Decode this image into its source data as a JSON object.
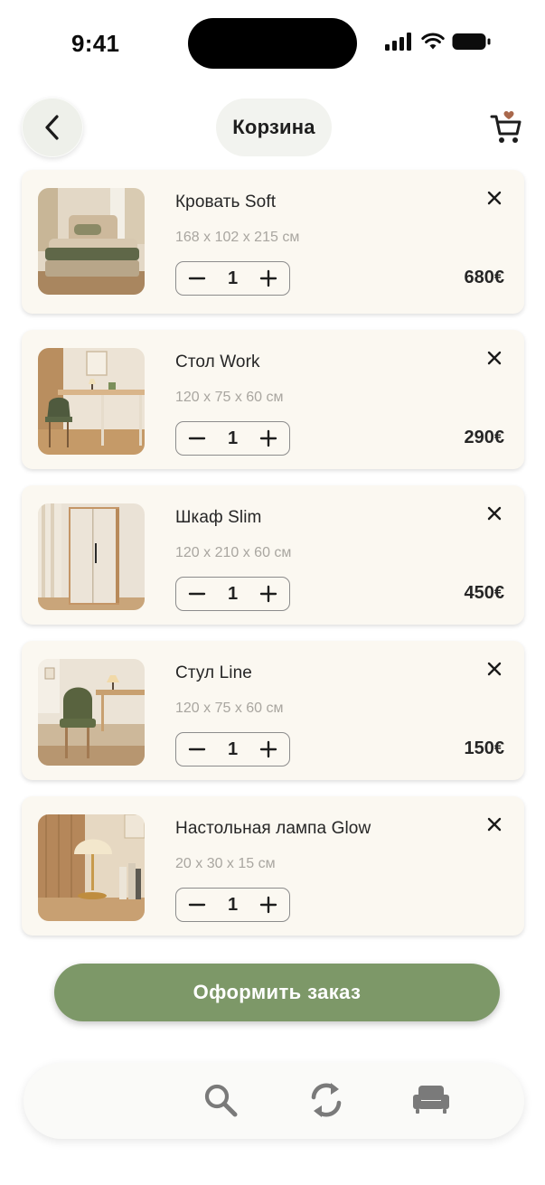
{
  "status_bar": {
    "time": "9:41"
  },
  "header": {
    "title": "Корзина"
  },
  "cart_items": [
    {
      "name": "Кровать Soft",
      "size": "168 x 102 x 215 см",
      "quantity": "1",
      "price": "680€",
      "image": "bed"
    },
    {
      "name": "Стол Work",
      "size": "120 x 75 x 60 см",
      "quantity": "1",
      "price": "290€",
      "image": "desk"
    },
    {
      "name": "Шкаф Slim",
      "size": "120 x 210 x 60 см",
      "quantity": "1",
      "price": "450€",
      "image": "wardrobe"
    },
    {
      "name": "Стул Line",
      "size": "120 x 75 x 60 см",
      "quantity": "1",
      "price": "150€",
      "image": "chair"
    },
    {
      "name": "Настольная лампа Glow",
      "size": "20 x 30 x 15 см",
      "quantity": "1",
      "price": "",
      "image": "lamp"
    }
  ],
  "checkout": {
    "label": "Оформить заказ"
  },
  "bottom_nav": {
    "items": [
      "search-icon",
      "sync-icon",
      "sofa-icon"
    ]
  },
  "colors": {
    "accent": "#7d9868",
    "card": "#fbf8f1",
    "background": "#ffffff"
  }
}
